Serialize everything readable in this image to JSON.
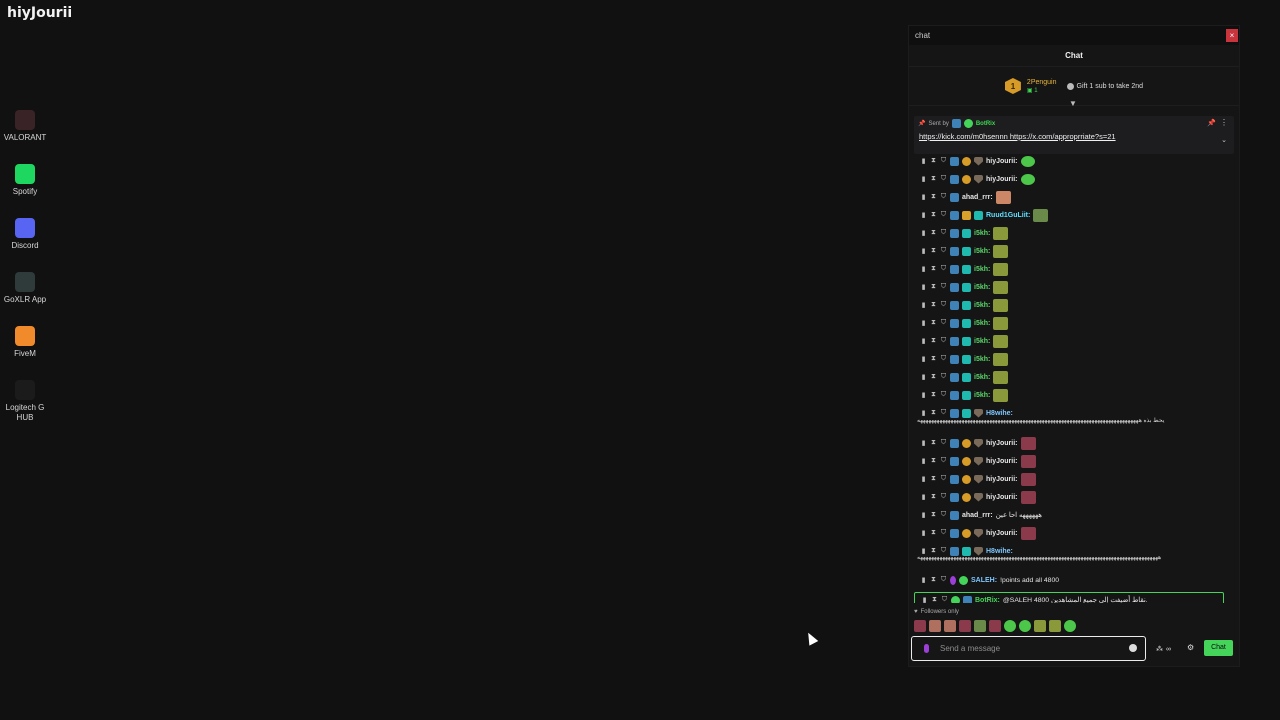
{
  "stream_title": "hiyJourii",
  "desktop_icons": [
    {
      "label": "VALORANT",
      "icon": "valorant-icon",
      "color": "#3a2326"
    },
    {
      "label": "Spotify",
      "icon": "spotify-icon",
      "color": "#1ed760"
    },
    {
      "label": "Discord",
      "icon": "discord-icon",
      "color": "#5865f2"
    },
    {
      "label": "GoXLR App",
      "icon": "goxlr-icon",
      "color": "#2f3a3a"
    },
    {
      "label": "FiveM",
      "icon": "fivem-icon",
      "color": "#f18a2a"
    },
    {
      "label": "Logitech G HUB",
      "icon": "logitech-icon",
      "color": "#1b1b1b"
    }
  ],
  "popout": {
    "title": "chat",
    "close": "×"
  },
  "chat": {
    "header": "Chat",
    "leader": {
      "rank": "1",
      "name": "2Penguin",
      "count": "1",
      "gift_text": "Gift 1 sub to take 2nd"
    },
    "pinned": {
      "sent_by_label": "Sent by",
      "sender": "BotRix",
      "links": "https://kick.com/m0hsennn https://x.com/approprriate?s=21"
    },
    "messages": [
      {
        "user": "hiyJourii:",
        "color": "#e6e6e6",
        "badges": [
          "blue",
          "sub",
          "shield"
        ],
        "emote": "frog"
      },
      {
        "user": "hiyJourii:",
        "color": "#e6e6e6",
        "badges": [
          "blue",
          "sub",
          "shield"
        ],
        "emote": "frog"
      },
      {
        "user": "ahad_rrr:",
        "color": "#e6e6e6",
        "badges": [
          "blue"
        ],
        "emote": "hand"
      },
      {
        "user": "Ruud1GuLiit:",
        "color": "#5fe0ff",
        "badges": [
          "blue",
          "crown",
          "teal"
        ],
        "emote": "ruud"
      },
      {
        "user": "i5kh:",
        "color": "#5bd86a",
        "badges": [
          "blue",
          "teal"
        ],
        "emote": "cat"
      },
      {
        "user": "i5kh:",
        "color": "#5bd86a",
        "badges": [
          "blue",
          "teal"
        ],
        "emote": "cat"
      },
      {
        "user": "i5kh:",
        "color": "#5bd86a",
        "badges": [
          "blue",
          "teal"
        ],
        "emote": "cat"
      },
      {
        "user": "i5kh:",
        "color": "#5bd86a",
        "badges": [
          "blue",
          "teal"
        ],
        "emote": "cat"
      },
      {
        "user": "i5kh:",
        "color": "#5bd86a",
        "badges": [
          "blue",
          "teal"
        ],
        "emote": "cat"
      },
      {
        "user": "i5kh:",
        "color": "#5bd86a",
        "badges": [
          "blue",
          "teal"
        ],
        "emote": "cat"
      },
      {
        "user": "i5kh:",
        "color": "#5bd86a",
        "badges": [
          "blue",
          "teal"
        ],
        "emote": "cat"
      },
      {
        "user": "i5kh:",
        "color": "#5bd86a",
        "badges": [
          "blue",
          "teal"
        ],
        "emote": "cat"
      },
      {
        "user": "i5kh:",
        "color": "#5bd86a",
        "badges": [
          "blue",
          "teal"
        ],
        "emote": "cat"
      },
      {
        "user": "i5kh:",
        "color": "#5bd86a",
        "badges": [
          "blue",
          "teal"
        ],
        "emote": "cat"
      },
      {
        "user": "H8wihe:",
        "color": "#7fc8ff",
        "badges": [
          "blue",
          "teal",
          "shield"
        ],
        "emote": ""
      },
      {
        "user": "hiyJourii:",
        "color": "#e6e6e6",
        "badges": [
          "blue",
          "sub",
          "shield"
        ],
        "emote": "rose"
      },
      {
        "user": "hiyJourii:",
        "color": "#e6e6e6",
        "badges": [
          "blue",
          "sub",
          "shield"
        ],
        "emote": "rose"
      },
      {
        "user": "hiyJourii:",
        "color": "#e6e6e6",
        "badges": [
          "blue",
          "sub",
          "shield"
        ],
        "emote": "rose"
      },
      {
        "user": "hiyJourii:",
        "color": "#e6e6e6",
        "badges": [
          "blue",
          "sub",
          "shield"
        ],
        "emote": "rose"
      },
      {
        "user": "ahad_rrr:",
        "color": "#e6e6e6",
        "badges": [
          "blue"
        ],
        "emote": "",
        "text": "ههههههه احا عين"
      },
      {
        "user": "hiyJourii:",
        "color": "#e6e6e6",
        "badges": [
          "blue",
          "sub",
          "shield"
        ],
        "emote": "rose"
      },
      {
        "user": "H8wihe:",
        "color": "#7fc8ff",
        "badges": [
          "blue",
          "teal",
          "shield"
        ],
        "emote": ""
      },
      {
        "user": "SALEH:",
        "color": "#7fc8ff",
        "badges": [
          "mic",
          "verified"
        ],
        "emote": "",
        "text": "!points add all 4800"
      },
      {
        "user": "BotRix:",
        "color": "#45d45a",
        "badges": [
          "verified",
          "blue"
        ],
        "emote": "",
        "text": "@SALEH 4800 نقاط أضيفت إلى جميع المشاهدين."
      }
    ],
    "wrap_line_1": "يحط بذه ههههههههههههههههههههههههههههههههههههههههههههههههههههههههههههههههههههههههههههههههه",
    "wrap_line_2": "هههههههههههههههههههههههههههههههههههههههههههههههههههههههههههههههههههههههههههههههههههههههه",
    "followers_only": "Followers only",
    "input_placeholder": "Send a message",
    "points_label": "∞",
    "send_label": "Chat"
  },
  "colors": {
    "accent": "#45d45a",
    "close": "#c9343d",
    "sub_badge": "#d79b27"
  }
}
